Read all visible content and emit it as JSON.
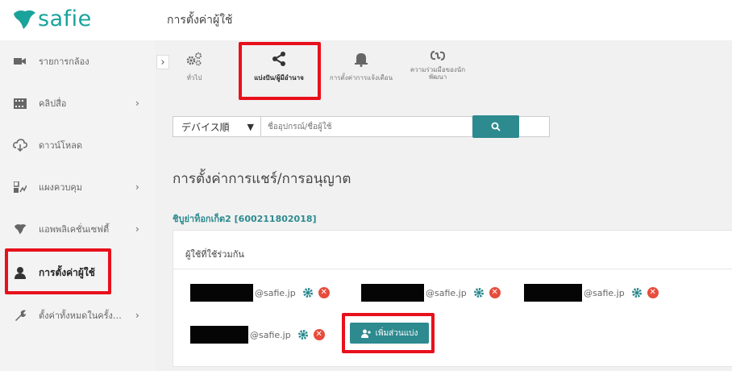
{
  "app": {
    "logo_text": "safie",
    "page_title": "การตั้งค่าผู้ใช้"
  },
  "colors": {
    "brand": "#1aa39b",
    "accent": "#2d8a8f",
    "highlight": "#e8101c",
    "danger": "#e74c3c"
  },
  "sidebar": {
    "items": [
      {
        "label": "รายการกล้อง",
        "icon": "video-camera-icon"
      },
      {
        "label": "คลิปสื่อ",
        "icon": "film-icon",
        "chevron": "›"
      },
      {
        "label": "ดาวน์โหลด",
        "icon": "cloud-download-icon"
      },
      {
        "label": "แผงควบคุม",
        "icon": "dashboard-icon",
        "chevron": "›"
      },
      {
        "label": "แอพพลิเคชั่นเซฟตี้",
        "icon": "safie-leaf-icon",
        "chevron": "›"
      },
      {
        "label": "การตั้งค่าผู้ใช้",
        "icon": "user-icon"
      },
      {
        "label": "ตั้งค่าทั้งหมดในครั้ง…",
        "icon": "wrench-icon",
        "chevron": "›"
      }
    ]
  },
  "tabs": [
    {
      "label": "ทั่วไป",
      "icon": "gears-icon"
    },
    {
      "label": "แบ่งปัน/ผู้มีอำนาจ",
      "icon": "share-icon"
    },
    {
      "label": "การตั้งค่าการแจ้งเตือน",
      "icon": "bell-icon"
    },
    {
      "label": "ความร่วมมือของนัก",
      "label2": "พัฒนา",
      "icon": "link-icon"
    }
  ],
  "search": {
    "sort_value": "デバイス順",
    "placeholder": "ชื่ออุปกรณ์/ชื่อผู้ใช้",
    "button_icon": "magnifier-icon"
  },
  "section": {
    "title": "การตั้งค่าการแชร์/การอนุญาต",
    "device_name": "ชิบูย่าท็อกเก็ต2 [600211802018]"
  },
  "shared_users": {
    "title": "ผู้ใช้ที่ใช้ร่วมกัน",
    "users": [
      {
        "email": "@safie.jp"
      },
      {
        "email": "@safie.jp"
      },
      {
        "email": "@safie.jp"
      },
      {
        "email": "@safie.jp"
      }
    ],
    "add_button_label": "เพิ่มส่วนแบ่ง"
  }
}
